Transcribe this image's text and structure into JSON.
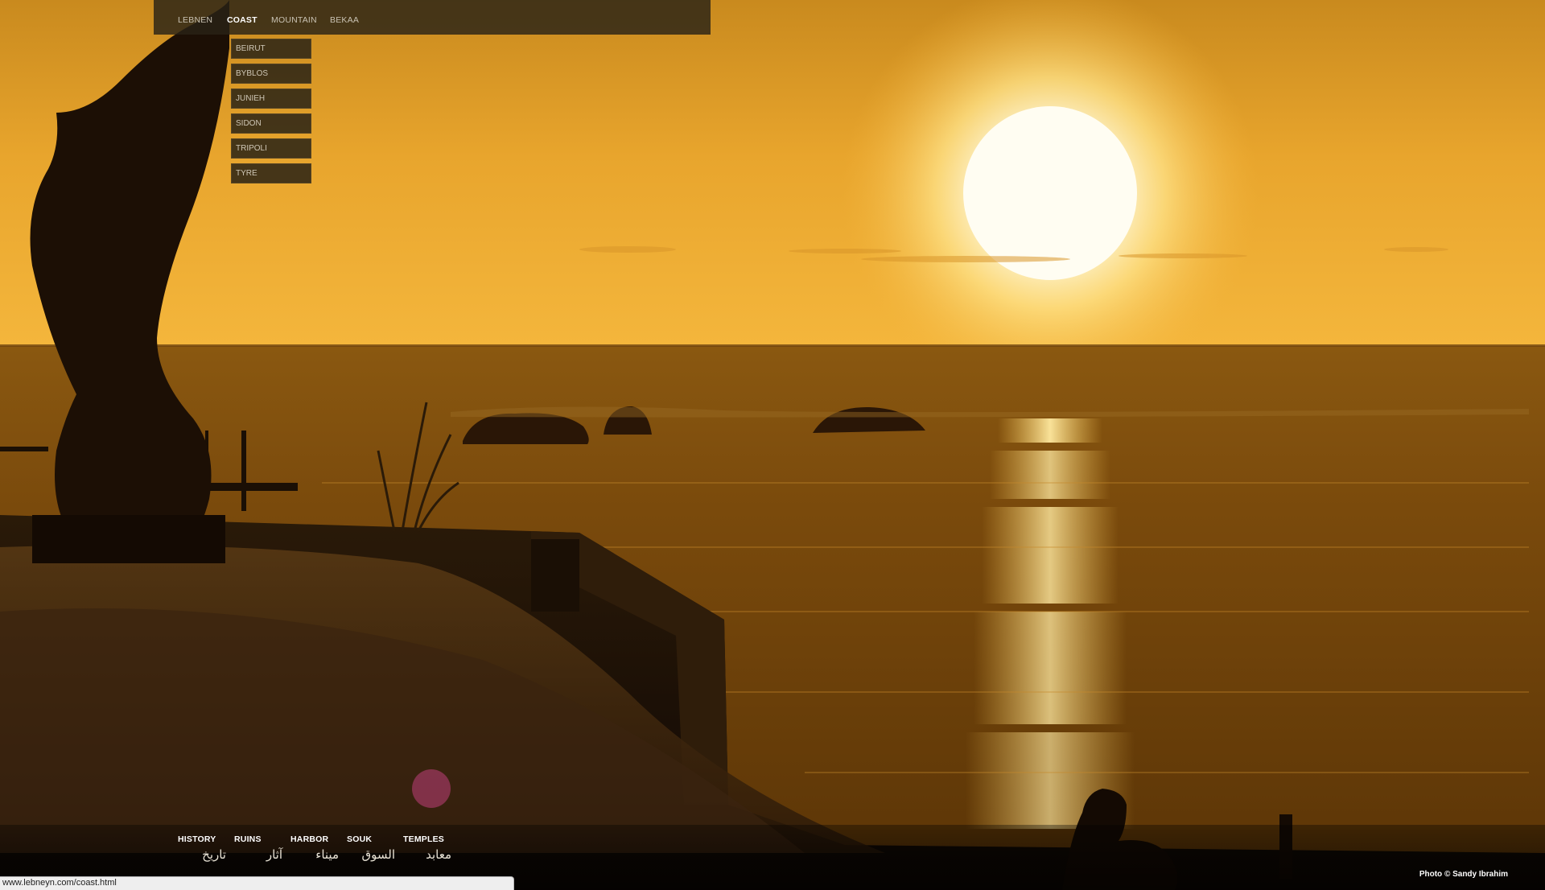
{
  "topnav": {
    "items": [
      {
        "label": "LEBNEN",
        "active": false
      },
      {
        "label": "COAST",
        "active": true
      },
      {
        "label": "MOUNTAIN",
        "active": false
      },
      {
        "label": "BEKAA",
        "active": false
      }
    ]
  },
  "dropdown": {
    "items": [
      "BEIRUT",
      "BYBLOS",
      "JUNIEH",
      "SIDON",
      "TRIPOLI",
      "TYRE"
    ]
  },
  "bottomnav": {
    "items": [
      {
        "en": "HISTORY",
        "ar": "تاريخ"
      },
      {
        "en": "RUINS",
        "ar": "آثار"
      },
      {
        "en": "HARBOR",
        "ar": "ميناء"
      },
      {
        "en": "SOUK",
        "ar": "السوق"
      },
      {
        "en": "TEMPLES",
        "ar": "معابد"
      }
    ]
  },
  "credit": "Photo © Sandy Ibrahim",
  "statusbar": {
    "url": "www.lebneyn.com/coast.html"
  },
  "colors": {
    "sky_top": "#e9a52a",
    "sky_horizon": "#f2b43a",
    "sun": "#fffbe8",
    "sea": "#7a4a0e",
    "nav_bg": "#2a2316"
  }
}
